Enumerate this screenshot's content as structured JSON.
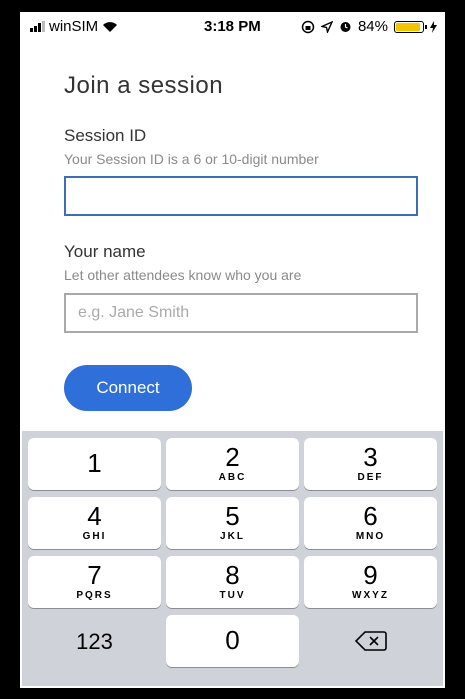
{
  "status_bar": {
    "carrier": "winSIM",
    "time": "3:18 PM",
    "battery_percent": "84%",
    "battery_level": 0.84,
    "icons": [
      "signal-bars-icon",
      "wifi-icon",
      "lock-rotation-icon",
      "location-arrow-icon",
      "alarm-icon",
      "battery-icon",
      "charging-bolt-icon"
    ]
  },
  "page": {
    "title": "Join a session"
  },
  "session_id": {
    "label": "Session ID",
    "help": "Your Session ID is a 6 or 10-digit number",
    "value": "",
    "placeholder": ""
  },
  "name": {
    "label": "Your name",
    "help": "Let other attendees know who you are",
    "value": "",
    "placeholder": "e.g. Jane Smith"
  },
  "connect_button": {
    "label": "Connect",
    "color": "#2f6fd9"
  },
  "keypad": {
    "keys": [
      {
        "num": "1",
        "letters": ""
      },
      {
        "num": "2",
        "letters": "ABC"
      },
      {
        "num": "3",
        "letters": "DEF"
      },
      {
        "num": "4",
        "letters": "GHI"
      },
      {
        "num": "5",
        "letters": "JKL"
      },
      {
        "num": "6",
        "letters": "MNO"
      },
      {
        "num": "7",
        "letters": "PQRS"
      },
      {
        "num": "8",
        "letters": "TUV"
      },
      {
        "num": "9",
        "letters": "WXYZ"
      },
      {
        "num": "0",
        "letters": ""
      }
    ],
    "mode_key": "123",
    "delete_icon": "backspace-icon"
  }
}
